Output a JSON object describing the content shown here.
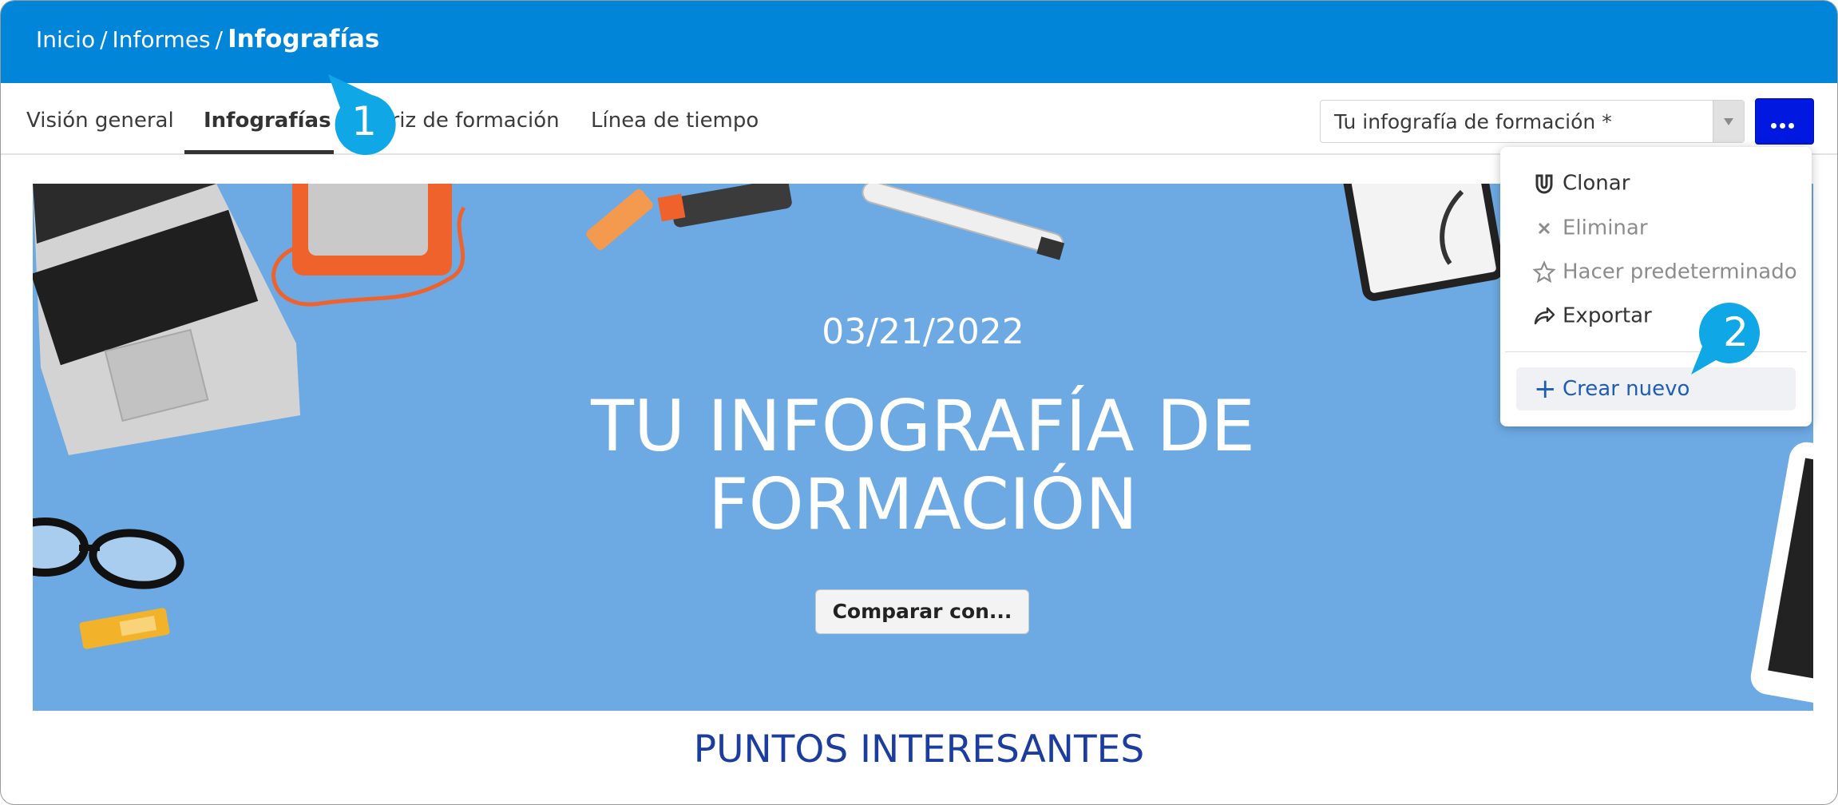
{
  "breadcrumb": {
    "home": "Inicio",
    "reports": "Informes",
    "current": "Infografías",
    "separator": "/"
  },
  "tabs": [
    {
      "label": "Visión general"
    },
    {
      "label": "Infografías"
    },
    {
      "label": "Matriz de formación"
    },
    {
      "label": "Línea de tiempo"
    }
  ],
  "selector": {
    "value": "Tu infografía de formación *"
  },
  "banner": {
    "date": "03/21/2022",
    "title_line1": "TU INFOGRAFÍA DE",
    "title_line2": "FORMACIÓN",
    "compare_label": "Comparar con..."
  },
  "section_title": "PUNTOS INTERESANTES",
  "menu": {
    "clone": "Clonar",
    "delete": "Eliminar",
    "make_default": "Hacer predeterminado",
    "export": "Exportar",
    "create_new": "Crear nuevo"
  },
  "callouts": {
    "one": "1",
    "two": "2"
  },
  "colors": {
    "header": "#0085d9",
    "banner": "#6da9e3",
    "more_button": "#0018e0",
    "callout": "#10a7e6",
    "section_title": "#1d3d9e"
  }
}
